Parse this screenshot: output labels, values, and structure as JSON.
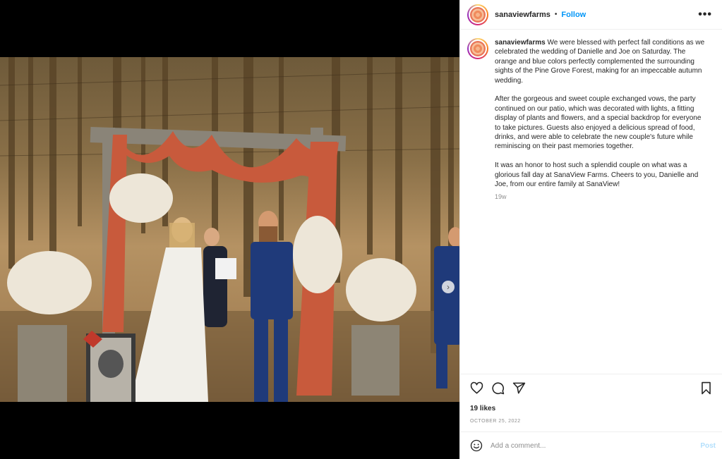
{
  "post": {
    "username": "sanaviewfarms",
    "separator": "•",
    "follow_label": "Follow",
    "more_label": "•••",
    "caption_username": "sanaviewfarms",
    "caption_p1": "We were blessed with perfect fall conditions as we celebrated the wedding of Danielle and Joe on Saturday. The orange and blue colors perfectly complemented the surrounding sights of the Pine Grove Forest, making for an impeccable autumn wedding.",
    "caption_p2": "After the gorgeous and sweet couple exchanged vows, the party continued on our patio, which was decorated with lights, a fitting display of plants and flowers, and a special backdrop for everyone to take pictures. Guests also enjoyed a delicious spread of food, drinks, and were able to celebrate the new couple's future while reminiscing on their past memories together.",
    "caption_p3": "It was an honor to host such a splendid couple on what was a glorious fall day at SanaView Farms. Cheers to you, Danielle and Joe, from our entire family at SanaView!",
    "time_ago": "19w",
    "likes": "19 likes",
    "date": "OCTOBER 25, 2022",
    "comment_placeholder": "Add a comment...",
    "post_label": "Post"
  },
  "carousel": {
    "next_icon": "›",
    "slide_count": 4,
    "active_index": 0
  },
  "colors": {
    "follow": "#0095f6",
    "post_disabled": "#b2dffc",
    "drape": "#c85a3c",
    "groom_suit": "#1f3a7a"
  },
  "icons": [
    "heart-icon",
    "comment-icon",
    "share-icon",
    "bookmark-icon",
    "emoji-icon",
    "more-icon",
    "chevron-right-icon"
  ]
}
